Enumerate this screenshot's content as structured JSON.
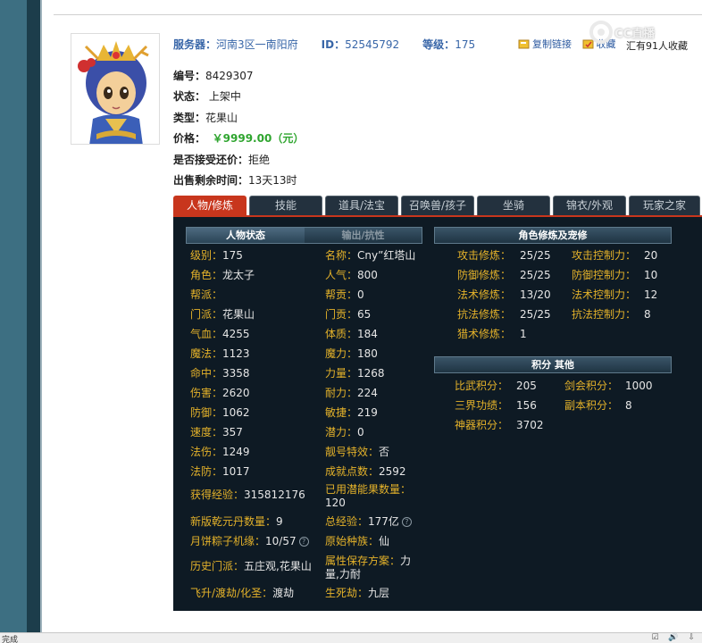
{
  "header": {
    "server_label": "服务器：",
    "server_value": "河南3区一南阳府",
    "id_label": "ID：",
    "id_value": "52545792",
    "level_label": "等级：",
    "level_value": "175",
    "serial_label": "编号：",
    "serial_value": "8429307",
    "status_label": "状态：",
    "status_value": "上架中",
    "type_label": "类型：",
    "type_value": "花果山",
    "price_label": "价格：",
    "price_value": "￥9999.00（元）",
    "counter_label": "是否接受还价：",
    "counter_value": "拒绝",
    "remain_label": "出售剩余时间：",
    "remain_value": "13天13时"
  },
  "actions": {
    "copy_link": "复制链接",
    "collect": "收藏",
    "collected_count": "汇有91人收藏"
  },
  "watermark": "CC直播",
  "tabs": [
    "人物/修炼",
    "技能",
    "道具/法宝",
    "召唤兽/孩子",
    "坐骑",
    "锦衣/外观",
    "玩家之家"
  ],
  "sections": {
    "char_status": "人物状态",
    "output_resist": "输出/抗性",
    "cultivation": "角色修炼及宠修",
    "points": "积分 其他"
  },
  "left_stats": [
    {
      "k": "级别：",
      "v": "175"
    },
    {
      "k": "角色：",
      "v": "龙太子"
    },
    {
      "k": "帮派：",
      "v": ""
    },
    {
      "k": "门派：",
      "v": "花果山"
    },
    {
      "k": "气血：",
      "v": "4255"
    },
    {
      "k": "魔法：",
      "v": "1123"
    },
    {
      "k": "命中：",
      "v": "3358"
    },
    {
      "k": "伤害：",
      "v": "2620"
    },
    {
      "k": "防御：",
      "v": "1062"
    },
    {
      "k": "速度：",
      "v": "357"
    },
    {
      "k": "法伤：",
      "v": "1249"
    },
    {
      "k": "法防：",
      "v": "1017"
    },
    {
      "k": "获得经验：",
      "v": "315812176"
    },
    {
      "k": "新版乾元丹数量：",
      "v": "9"
    },
    {
      "k": "月饼粽子机缘：",
      "v": "10/57"
    },
    {
      "k": "历史门派：",
      "v": "五庄观,花果山"
    },
    {
      "k": "飞升/渡劫/化圣：",
      "v": "渡劫"
    }
  ],
  "mid_stats": [
    {
      "k": "名称：",
      "v": "Cny”红塔山"
    },
    {
      "k": "人气：",
      "v": "800"
    },
    {
      "k": "帮贡：",
      "v": "0"
    },
    {
      "k": "门贡：",
      "v": "65"
    },
    {
      "k": "体质：",
      "v": "184"
    },
    {
      "k": "魔力：",
      "v": "180"
    },
    {
      "k": "力量：",
      "v": "1268"
    },
    {
      "k": "耐力：",
      "v": "224"
    },
    {
      "k": "敏捷：",
      "v": "219"
    },
    {
      "k": "潜力：",
      "v": "0"
    },
    {
      "k": "靓号特效：",
      "v": "否"
    },
    {
      "k": "成就点数：",
      "v": "2592"
    },
    {
      "k": "已用潜能果数量：",
      "v": "120"
    },
    {
      "k": "总经验：",
      "v": "177亿"
    },
    {
      "k": "原始种族：",
      "v": "仙"
    },
    {
      "k": "属性保存方案：",
      "v": "力量,力耐"
    },
    {
      "k": "生死劫：",
      "v": "九层"
    }
  ],
  "cultivation": [
    {
      "k": "攻击修炼：",
      "v": "25/25",
      "k2": "攻击控制力：",
      "v2": "20"
    },
    {
      "k": "防御修炼：",
      "v": "25/25",
      "k2": "防御控制力：",
      "v2": "10"
    },
    {
      "k": "法术修炼：",
      "v": "13/20",
      "k2": "法术控制力：",
      "v2": "12"
    },
    {
      "k": "抗法修炼：",
      "v": "25/25",
      "k2": "抗法控制力：",
      "v2": "8"
    },
    {
      "k": "猎术修炼：",
      "v": "1",
      "k2": "",
      "v2": ""
    }
  ],
  "points": [
    {
      "k": "比武积分：",
      "v": "205",
      "k2": "剑会积分：",
      "v2": "1000"
    },
    {
      "k": "三界功绩：",
      "v": "156",
      "k2": "副本积分：",
      "v2": "8"
    },
    {
      "k": "神器积分：",
      "v": "3702",
      "k2": "",
      "v2": ""
    }
  ],
  "status_bar": {
    "left": "完成",
    "right": "☑ 🔊 ⇩"
  },
  "colors": {
    "accent_red": "#c8361d",
    "panel_bg": "#0e1a24",
    "label_gold": "#e4b22a",
    "price_green": "#2fa52f",
    "link_blue": "#3866a8"
  }
}
